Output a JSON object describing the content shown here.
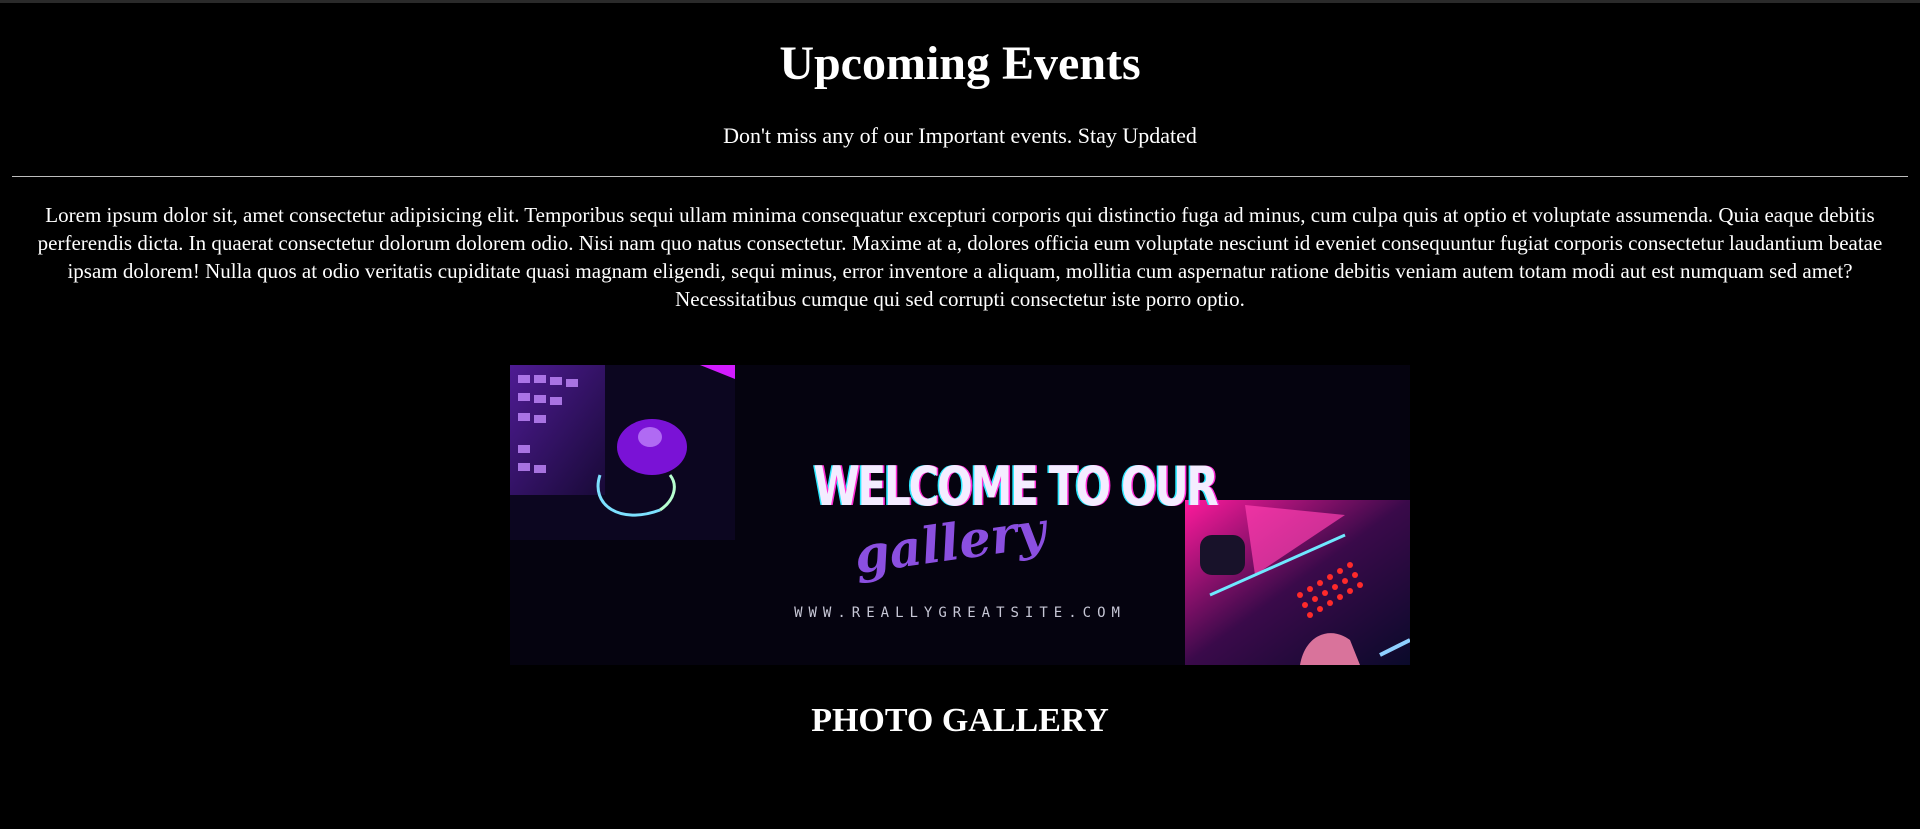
{
  "header": {
    "title": "Upcoming Events",
    "subtitle": "Don't miss any of our Important events. Stay Updated"
  },
  "intro": {
    "text": "Lorem ipsum dolor sit, amet consectetur adipisicing elit. Temporibus sequi ullam minima consequatur excepturi corporis qui distinctio fuga ad minus, cum culpa quis at optio et voluptate assumenda. Quia eaque debitis perferendis dicta. In quaerat consectetur dolorum dolorem odio. Nisi nam quo natus consectetur. Maxime at a, dolores officia eum voluptate nesciunt id eveniet consequuntur fugiat corporis consectetur laudantium beatae ipsam dolorem! Nulla quos at odio veritatis cupiditate quasi magnam eligendi, sequi minus, error inventore a aliquam, mollitia cum aspernatur ratione debitis veniam autem totam modi aut est numquam sed amet? Necessitatibus cumque qui sed corrupti consectetur iste porro optio."
  },
  "banner": {
    "headline": "WELCOME TO OUR",
    "script": "gallery",
    "url": "WWW.REALLYGREATSITE.COM",
    "colors": {
      "background": "#05030f",
      "accent_pink": "#ff2bd6",
      "accent_purple": "#8b4fe0",
      "accent_cyan": "#2be8ff"
    },
    "icons": [
      "keyboard-icon",
      "mouse-icon",
      "gamepad-icon"
    ]
  },
  "gallery": {
    "title": "PHOTO GALLERY"
  }
}
